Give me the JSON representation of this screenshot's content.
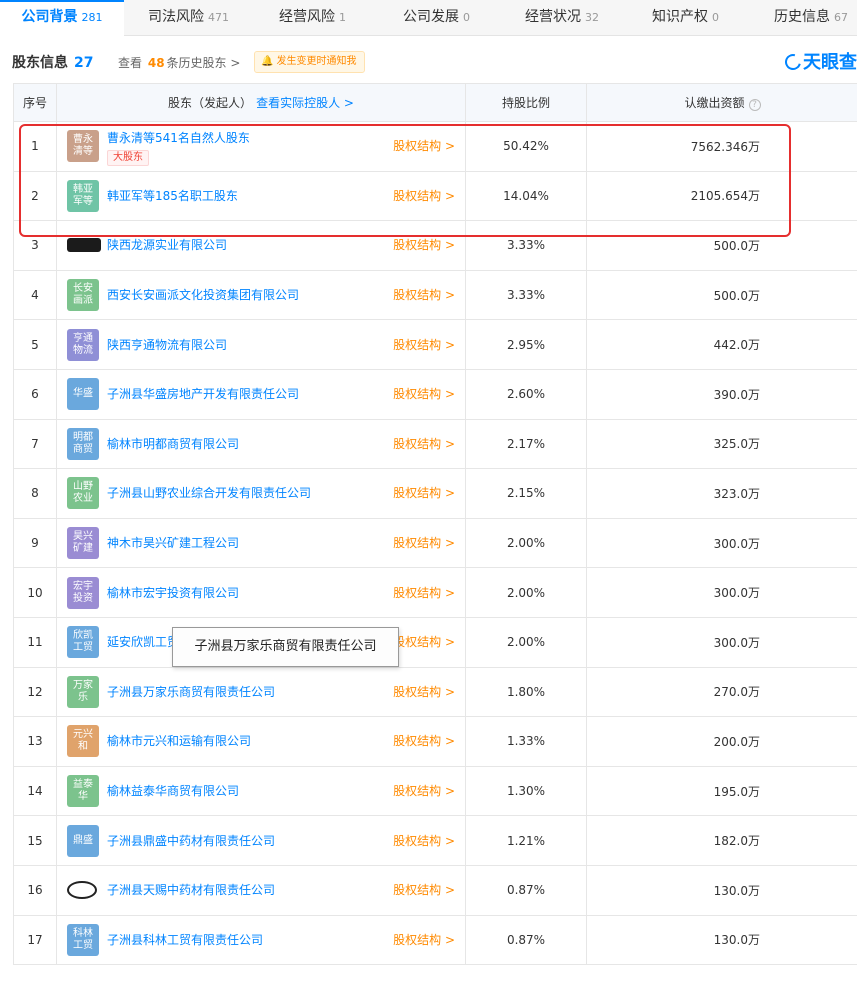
{
  "tabs": [
    {
      "label": "公司背景",
      "count": "281",
      "active": true
    },
    {
      "label": "司法风险",
      "count": "471"
    },
    {
      "label": "经营风险",
      "count": "1"
    },
    {
      "label": "公司发展",
      "count": "0"
    },
    {
      "label": "经营状况",
      "count": "32"
    },
    {
      "label": "知识产权",
      "count": "0"
    },
    {
      "label": "历史信息",
      "count": "67"
    }
  ],
  "section": {
    "title": "股东信息",
    "count": "27",
    "history_prefix": "查看",
    "history_count": "48",
    "history_suffix": "条历史股东 >",
    "notify_label": "发生变更时通知我",
    "brand": "天眼查"
  },
  "table": {
    "headers": {
      "index": "序号",
      "name": "股东（发起人）",
      "name_link": "查看实际控股人 >",
      "ratio": "持股比例",
      "capital": "认缴出资额"
    },
    "equity_label": "股权结构 >",
    "rows": [
      {
        "index": "1",
        "avatar": "曹永清等",
        "color": "#c9a08a",
        "name": "曹永清等541名自然人股东",
        "tag": "大股东",
        "ratio": "50.42%",
        "capital": "7562.346万"
      },
      {
        "index": "2",
        "avatar": "韩亚军等",
        "color": "#6fc4a6",
        "name": "韩亚军等185名职工股东",
        "ratio": "14.04%",
        "capital": "2105.654万"
      },
      {
        "index": "3",
        "avatar": "",
        "avatar_style": "dark",
        "color": "#1b1b1b",
        "name": "陕西龙源实业有限公司",
        "ratio": "3.33%",
        "capital": "500.0万"
      },
      {
        "index": "4",
        "avatar": "长安画派",
        "color": "#7cc38d",
        "name": "西安长安画派文化投资集团有限公司",
        "ratio": "3.33%",
        "capital": "500.0万"
      },
      {
        "index": "5",
        "avatar": "亨通物流",
        "color": "#8f8fd6",
        "name": "陕西亨通物流有限公司",
        "ratio": "2.95%",
        "capital": "442.0万"
      },
      {
        "index": "6",
        "avatar": "华盛",
        "color": "#6aa8dd",
        "name": "子洲县华盛房地产开发有限责任公司",
        "ratio": "2.60%",
        "capital": "390.0万"
      },
      {
        "index": "7",
        "avatar": "明都商贸",
        "color": "#6aa8dd",
        "name": "榆林市明都商贸有限公司",
        "ratio": "2.17%",
        "capital": "325.0万"
      },
      {
        "index": "8",
        "avatar": "山野农业",
        "color": "#7cc38d",
        "name": "子洲县山野农业综合开发有限责任公司",
        "ratio": "2.15%",
        "capital": "323.0万"
      },
      {
        "index": "9",
        "avatar": "昊兴矿建",
        "color": "#9a8cd3",
        "name": "神木市昊兴矿建工程公司",
        "ratio": "2.00%",
        "capital": "300.0万"
      },
      {
        "index": "10",
        "avatar": "宏宇投资",
        "color": "#9a8cd3",
        "name": "榆林市宏宇投资有限公司",
        "ratio": "2.00%",
        "capital": "300.0万"
      },
      {
        "index": "11",
        "avatar": "欣凯工贸",
        "color": "#6aa8dd",
        "name": "延安欣凯工贸有限公司",
        "ratio": "2.00%",
        "capital": "300.0万"
      },
      {
        "index": "12",
        "avatar": "万家乐",
        "color": "#7cc38d",
        "name": "子洲县万家乐商贸有限责任公司",
        "ratio": "1.80%",
        "capital": "270.0万"
      },
      {
        "index": "13",
        "avatar": "元兴和",
        "color": "#e0a36b",
        "name": "榆林市元兴和运输有限公司",
        "ratio": "1.33%",
        "capital": "200.0万"
      },
      {
        "index": "14",
        "avatar": "益泰华",
        "color": "#7cc38d",
        "name": "榆林益泰华商贸有限公司",
        "ratio": "1.30%",
        "capital": "195.0万"
      },
      {
        "index": "15",
        "avatar": "鼎盛",
        "color": "#6aa8dd",
        "name": "子洲县鼎盛中药材有限责任公司",
        "ratio": "1.21%",
        "capital": "182.0万"
      },
      {
        "index": "16",
        "avatar": "",
        "avatar_style": "stamp",
        "color": "#222222",
        "name": "子洲县天赐中药材有限责任公司",
        "ratio": "0.87%",
        "capital": "130.0万"
      },
      {
        "index": "17",
        "avatar": "科林工贸",
        "color": "#6aa8dd",
        "name": "子洲县科林工贸有限责任公司",
        "ratio": "0.87%",
        "capital": "130.0万"
      }
    ]
  },
  "tooltip": "子洲县万家乐商贸有限责任公司"
}
